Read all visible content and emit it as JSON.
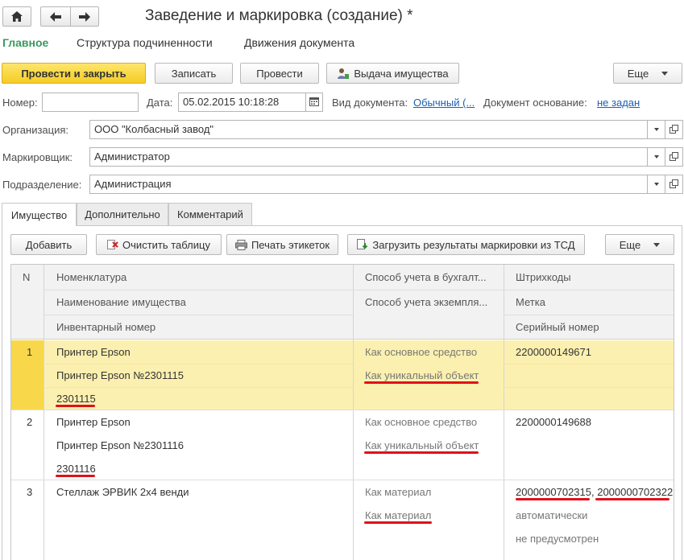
{
  "window": {
    "title": "Заведение и маркировка (создание) *",
    "nav": {
      "home_icon": "home-icon",
      "back_icon": "arrow-left-icon",
      "forward_icon": "arrow-right-icon"
    }
  },
  "sections": [
    "Главное",
    "Структура подчиненности",
    "Движения документа"
  ],
  "toolbar": {
    "post_close": "Провести и закрыть",
    "save": "Записать",
    "post": "Провести",
    "issue": "Выдача имущества",
    "more": "Еще"
  },
  "header": {
    "number_label": "Номер:",
    "number_value": "",
    "date_label": "Дата:",
    "date_value": "05.02.2015 10:18:28",
    "doc_type_label": "Вид документа:",
    "doc_type_value": "Обычный (...",
    "basis_label": "Документ основание:",
    "basis_value": "не задан",
    "org_label": "Организация:",
    "org_value": "ООО \"Колбасный завод\"",
    "marker_label": "Маркировщик:",
    "marker_value": "Администратор",
    "dept_label": "Подразделение:",
    "dept_value": "Администрация"
  },
  "tabs": [
    "Имущество",
    "Дополнительно",
    "Комментарий"
  ],
  "table_toolbar": {
    "add": "Добавить",
    "clear": "Очистить таблицу",
    "print": "Печать этикеток",
    "load": "Загрузить результаты маркировки из ТСД",
    "more": "Еще"
  },
  "table": {
    "headers": {
      "n": "N",
      "col1": [
        "Номенклатура",
        "Наименование имущества",
        "Инвентарный номер"
      ],
      "col2": [
        "Способ учета в бухгалт...",
        "Способ учета экземпля..."
      ],
      "col3": [
        "Штрихкоды",
        "Метка",
        "Серийный номер"
      ]
    },
    "rows": [
      {
        "n": "1",
        "c1": [
          "Принтер Epson",
          "Принтер Epson №2301115",
          "2301115"
        ],
        "c2": [
          "Как основное средство",
          "Как уникальный объект"
        ],
        "c3": [
          "2200000149671",
          "",
          ""
        ]
      },
      {
        "n": "2",
        "c1": [
          "Принтер Epson",
          "Принтер Epson №2301116",
          "2301116"
        ],
        "c2": [
          "Как основное средство",
          "Как уникальный объект"
        ],
        "c3": [
          "2200000149688",
          "",
          ""
        ]
      },
      {
        "n": "3",
        "c1": [
          "Стеллаж ЭРВИК 2х4 венди",
          "",
          ""
        ],
        "c2": [
          "Как материал",
          "Как материал"
        ],
        "c3": [
          "2000000702315, 2000000702322",
          "автоматически",
          "не предусмотрен"
        ],
        "c3_barcodes": [
          "2000000702315",
          "2000000702322"
        ]
      }
    ]
  },
  "colors": {
    "primary_button": "#f5cc25",
    "active_section": "#3a9a5b",
    "selected_row": "#fcf0b0",
    "link": "#1a5fb4",
    "annotation": "#e0101a"
  }
}
